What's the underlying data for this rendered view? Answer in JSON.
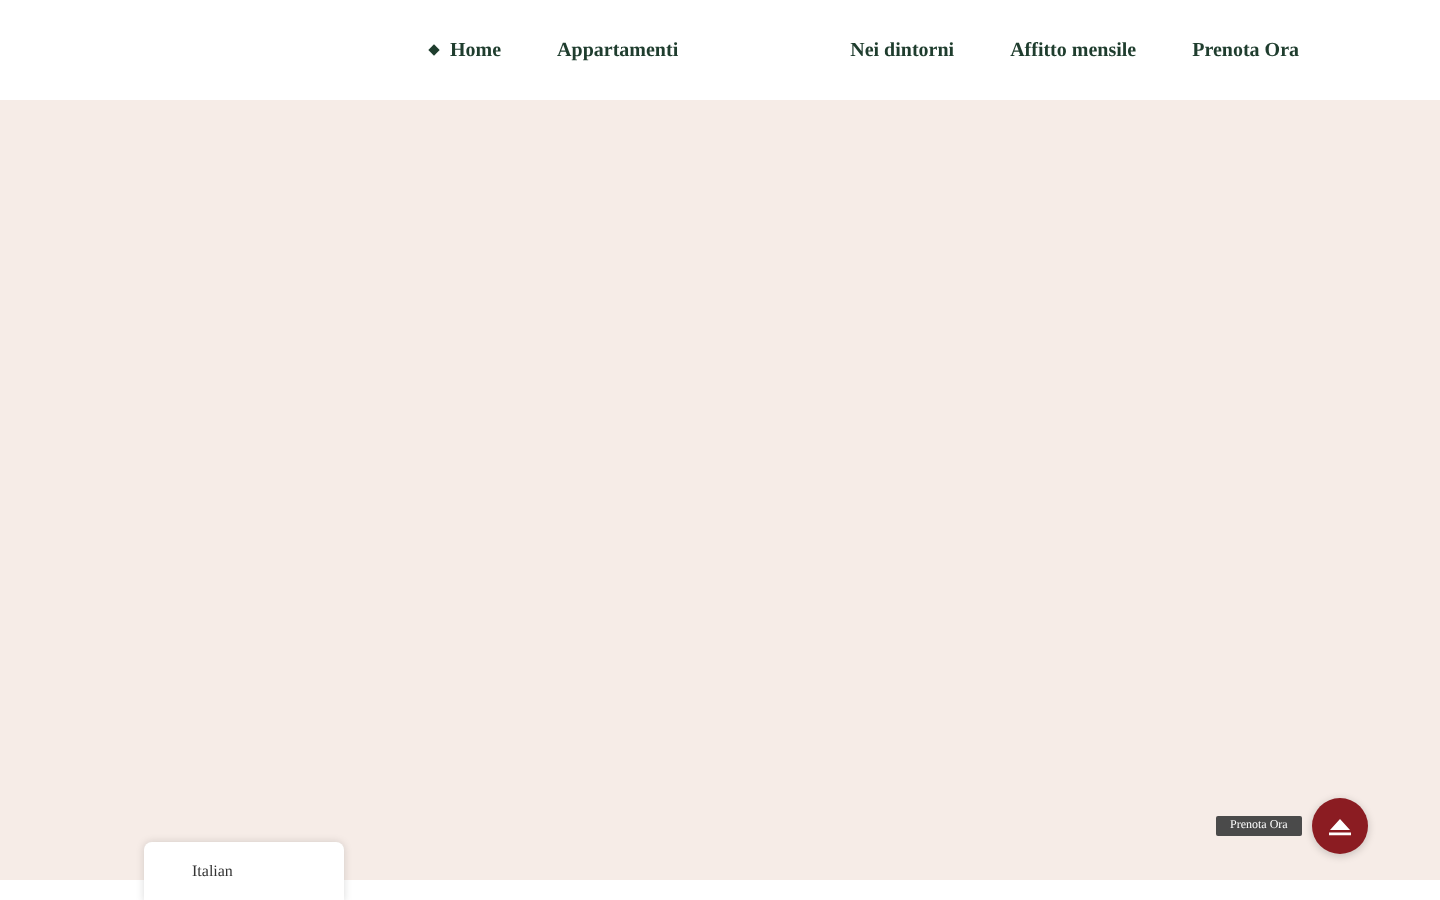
{
  "nav": [
    {
      "label": "Home",
      "selected": true
    },
    {
      "label": "Appartamenti",
      "selected": false
    },
    {
      "label": "Nei dintorni",
      "selected": false
    },
    {
      "label": "Affitto mensile",
      "selected": false
    },
    {
      "label": "Prenota Ora",
      "selected": false
    }
  ],
  "booking_button": {
    "tooltip": "Prenota Ora"
  },
  "language_switcher": {
    "label": "Italian"
  }
}
